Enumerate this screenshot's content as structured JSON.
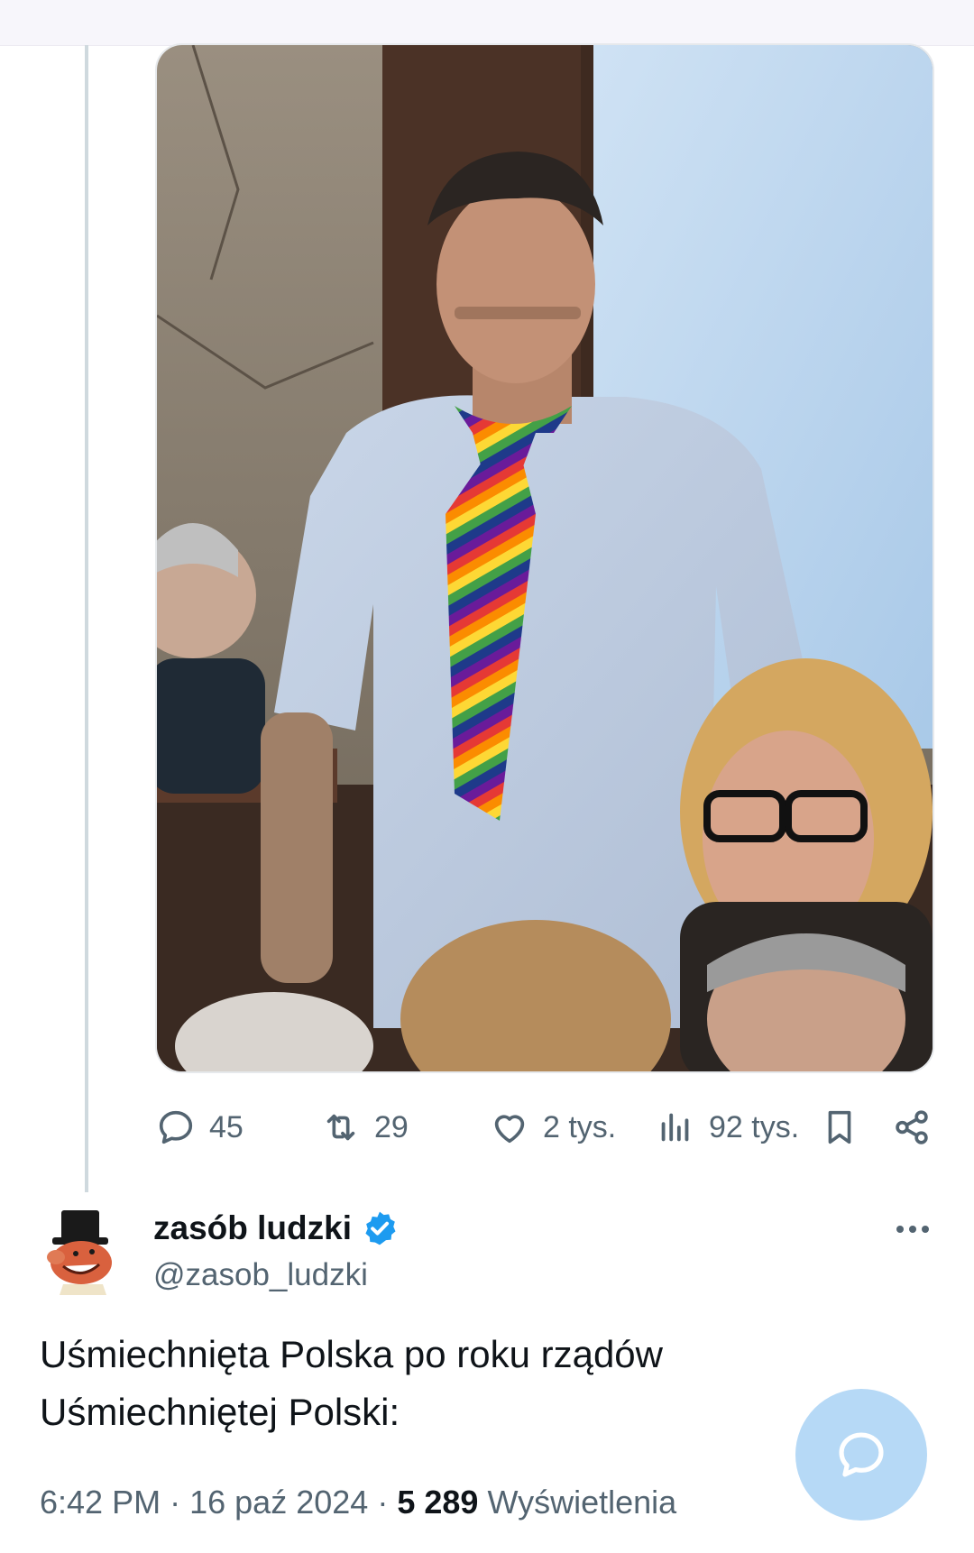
{
  "photo": {
    "icon": "photo-of-man-with-rainbow-tie"
  },
  "actions": {
    "replies": "45",
    "reposts": "29",
    "likes": "2 tys.",
    "views": "92 tys."
  },
  "author": {
    "name": "zasób ludzki",
    "handle": "@zasob_ludzki",
    "verified": true
  },
  "tweet": {
    "text_line1": "Uśmiechnięta Polska po roku rządów",
    "text_line2": "Uśmiechniętej Polski:",
    "time": "6:42 PM",
    "date": "16 paź 2024",
    "views_count": "5 289",
    "views_label": "Wyświetlenia",
    "separator": "·"
  },
  "colors": {
    "muted": "#536471",
    "text": "#0f1419",
    "verified": "#1d9bf0",
    "fab": "#b6d9f6",
    "thread_line": "#cfd9de"
  }
}
